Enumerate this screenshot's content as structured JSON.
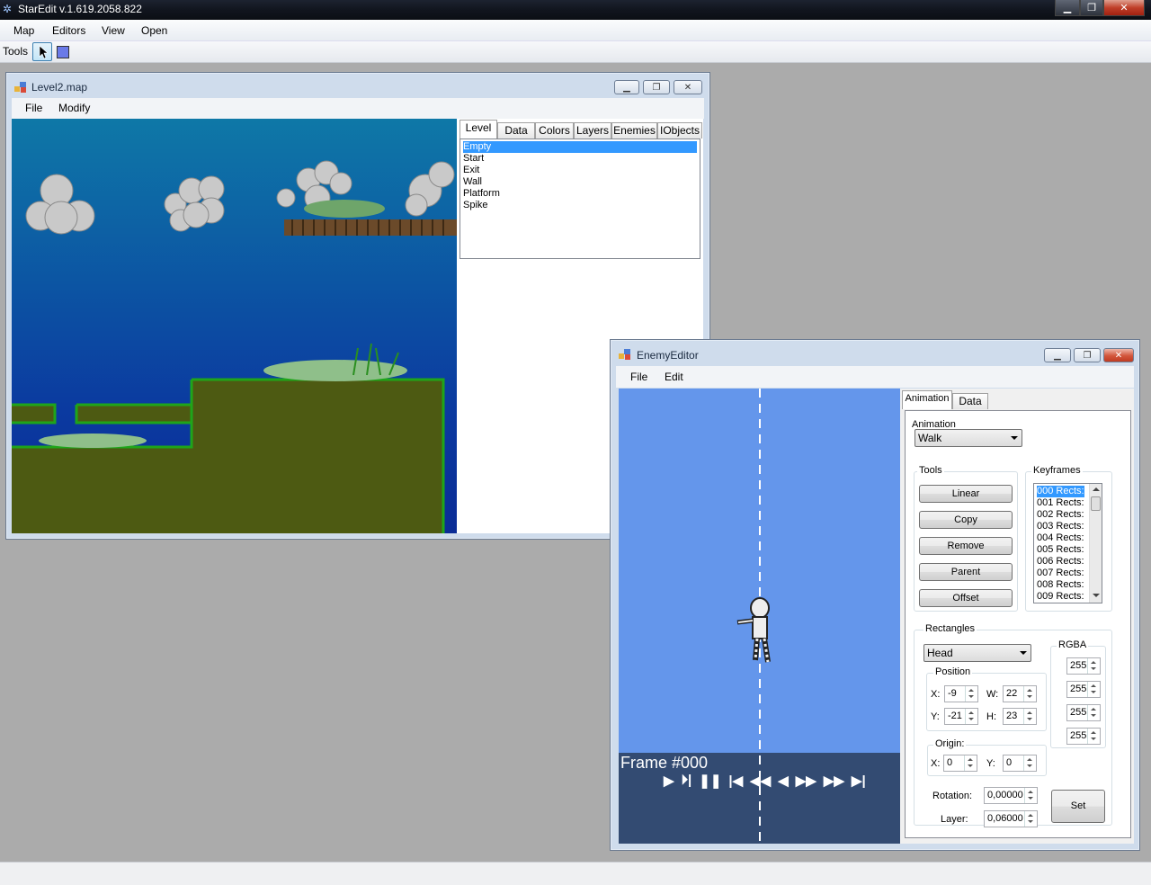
{
  "app": {
    "title": "StarEdit v.1.619.2058.822"
  },
  "menu": [
    "Map",
    "Editors",
    "View",
    "Open"
  ],
  "toolbar": {
    "label": "Tools",
    "color_swatch": "#6a7ae8"
  },
  "level_window": {
    "title": "Level2.map",
    "menu": [
      "File",
      "Modify"
    ],
    "tabs": [
      "Level",
      "Data",
      "Colors",
      "Layers",
      "Enemies",
      "IObjects"
    ],
    "active_tab": "Level",
    "list_items": [
      "Empty",
      "Start",
      "Exit",
      "Wall",
      "Platform",
      "Spike"
    ],
    "selected_item": "Empty"
  },
  "enemy_window": {
    "title": "EnemyEditor",
    "menu": [
      "File",
      "Edit"
    ],
    "tabs": [
      "Animation",
      "Data"
    ],
    "active_tab": "Animation",
    "frame_label": "Frame #000",
    "animation": {
      "label": "Animation",
      "selected": "Walk"
    },
    "tools": {
      "label": "Tools",
      "buttons": [
        "Linear",
        "Copy",
        "Remove",
        "Parent",
        "Offset"
      ]
    },
    "keyframes": {
      "label": "Keyframes",
      "items": [
        "000 Rects:",
        "001 Rects:",
        "002 Rects:",
        "003 Rects:",
        "004 Rects:",
        "005 Rects:",
        "006 Rects:",
        "007 Rects:",
        "008 Rects:",
        "009 Rects:"
      ],
      "selected": "000 Rects:"
    },
    "rectangles": {
      "label": "Rectangles",
      "selected": "Head",
      "position": {
        "label": "Position",
        "x_label": "X:",
        "x": "-9",
        "y_label": "Y:",
        "y": "-21",
        "w_label": "W:",
        "w": "22",
        "h_label": "H:",
        "h": "23"
      },
      "origin": {
        "label": "Origin:",
        "x_label": "X:",
        "x": "0",
        "y_label": "Y:",
        "y": "0"
      },
      "rotation_label": "Rotation:",
      "rotation": "0,00000",
      "layer_label": "Layer:",
      "layer": "0,06000",
      "set_label": "Set",
      "rgba": {
        "label": "RGBA",
        "values": [
          "255",
          "255",
          "255",
          "255"
        ]
      }
    },
    "playback_icons": [
      "play-icon",
      "step-forward-icon",
      "pause-icon",
      "skip-start-icon",
      "fast-rewind-icon",
      "rewind-icon",
      "forward-icon",
      "fast-forward-icon",
      "skip-end-icon"
    ]
  },
  "colors": {
    "sky_top": "#0b6b9c",
    "sky_bottom": "#0b1f8a",
    "ground": "#5a3d0c",
    "canvas_blue": "#6496eb",
    "canvas_dark": "#334b72"
  }
}
